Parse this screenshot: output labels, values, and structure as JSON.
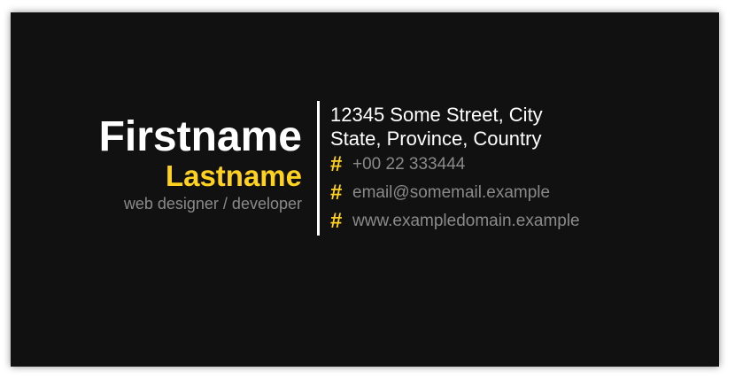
{
  "card": {
    "first_name": "Firstname",
    "last_name": "Lastname",
    "job_title": "web designer / developer",
    "address": {
      "line1": "12345 Some Street, City",
      "line2": "State, Province, Country"
    },
    "contacts": [
      {
        "icon": "#",
        "text": "+00 22 333444"
      },
      {
        "icon": "#",
        "text": "email@somemail.example"
      },
      {
        "icon": "#",
        "text": "www.exampledomain.example"
      }
    ]
  },
  "colors": {
    "background": "#111111",
    "accent": "#ffd21f",
    "primary_text": "#ffffff",
    "muted_text": "#8a8a8a"
  }
}
